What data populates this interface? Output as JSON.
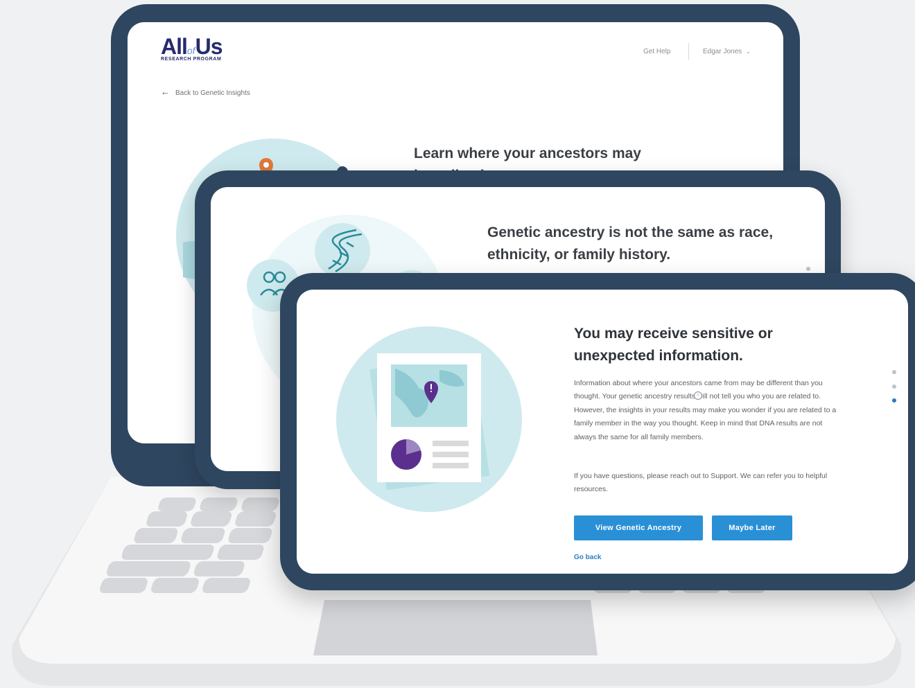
{
  "app": {
    "logo": {
      "main_left": "All",
      "main_of": "of",
      "main_right": "Us",
      "sub": "RESEARCH PROGRAM"
    },
    "nav": {
      "help_label": "Get Help",
      "user_label": "Edgar Jones",
      "user_chevron": "chevron-down-icon"
    },
    "back_link": {
      "label": "Back to Genetic Insights",
      "icon": "arrow-left-icon"
    }
  },
  "screen1": {
    "heading_line1": "Learn where your ancestors may",
    "heading_line2": "have lived."
  },
  "screen2": {
    "heading": "Genetic ancestry is not the same as race, ethnicity, or family history."
  },
  "screen3": {
    "heading": "You may receive sensitive or unexpected information.",
    "paragraph1": "Information about where your ancestors came from may be different than you thought. Your genetic ancestry results will not tell you who you are related to. However, the insights in your results may make you wonder if you are related to a family member in the way you thought. Keep in mind that DNA results are not always the same for all family members.",
    "paragraph2": "If you have questions, please reach out to Support. We can refer you to helpful resources.",
    "primary_button": "View Genetic Ancestry",
    "secondary_button": "Maybe Later",
    "go_back": "Go back",
    "info_icon": "info-icon"
  },
  "pagination": {
    "total": 3,
    "active_index": 2
  },
  "colors": {
    "frame": "#2f4660",
    "accent": "#2a90d6",
    "teal": "#b6e0e4",
    "purple": "#5b2f8e",
    "pin_orange": "#e07a3c"
  }
}
